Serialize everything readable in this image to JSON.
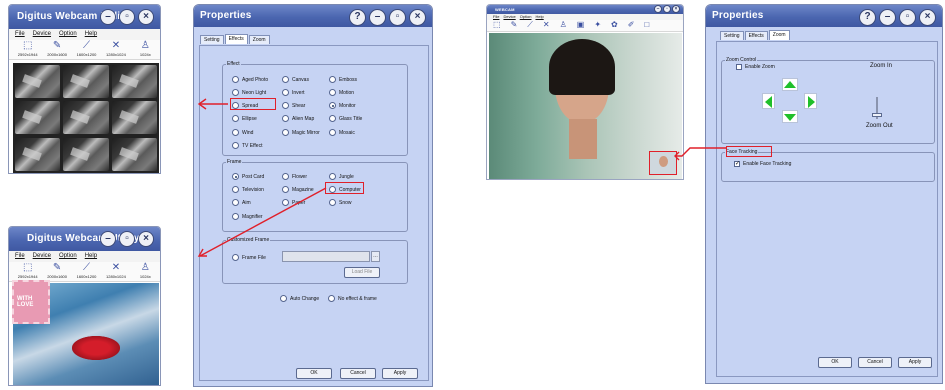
{
  "webcam": {
    "title": "Digitus Webcam Utility",
    "menu": [
      "File",
      "Device",
      "Option",
      "Help"
    ],
    "toolbar": [
      "2592x1944",
      "2000x1600",
      "1600x1200",
      "1280x1024",
      "1024x"
    ],
    "stamp_text": "WITH LOVE"
  },
  "props_left": {
    "title": "Properties",
    "tabs": [
      "Setting",
      "Effects",
      "Zoom"
    ],
    "effect_label": "Effect",
    "effects": [
      "Aged Photo",
      "Canvas",
      "Emboss",
      "Neon Light",
      "Invert",
      "Motion",
      "Spread",
      "Shear",
      "Monitor",
      "Ellipse",
      "Alien Map",
      "Glass Title",
      "Wind",
      "Magic Mirror",
      "Mosaic",
      "TV Effect"
    ],
    "frame_label": "Frame",
    "frames": [
      "Post Card",
      "Flower",
      "Jungle",
      "Television",
      "Magazine",
      "Computer",
      "Aim",
      "Paper",
      "Snow",
      "Magnifier"
    ],
    "custom_label": "Customized Frame",
    "frame_file": "Frame File",
    "load_file": "Load File",
    "auto_change": "Auto Change",
    "no_effect": "No effect & frame",
    "ok": "OK",
    "cancel": "Cancel",
    "apply": "Apply"
  },
  "cam_window": {
    "title": "WEBCAM",
    "menu": [
      "File",
      "Device",
      "Option",
      "Help"
    ]
  },
  "props_right": {
    "title": "Properties",
    "tabs": [
      "Setting",
      "Effects",
      "Zoom"
    ],
    "zoom_control_label": "Zoom Control",
    "enable_zoom": "Enable Zoom",
    "zoom_in": "Zoom In",
    "zoom_out": "Zoom Out",
    "face_tracking_label": "Face Tracking",
    "enable_face_tracking": "Enable Face Tracking",
    "ok": "OK",
    "cancel": "Cancel",
    "apply": "Apply"
  },
  "colors": {
    "title_bar": "#4b66b0",
    "dialog_bg": "#c6d3f3",
    "highlight": "#e0202a",
    "arrow_green": "#1fbf2a"
  }
}
